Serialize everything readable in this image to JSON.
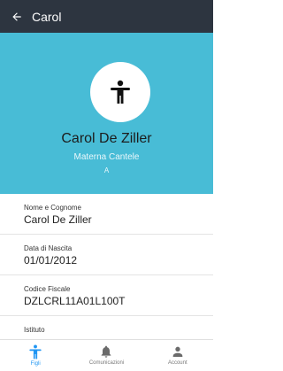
{
  "appbar": {
    "title": "Carol"
  },
  "profile": {
    "name": "Carol De Ziller",
    "school": "Materna Cantele",
    "section": "A"
  },
  "fields": [
    {
      "label": "Nome e Cognome",
      "value": "Carol De Ziller"
    },
    {
      "label": "Data di Nascita",
      "value": "01/01/2012"
    },
    {
      "label": "Codice Fiscale",
      "value": "DZLCRL11A01L100T"
    },
    {
      "label": "Istituto",
      "value": ""
    }
  ],
  "nav": [
    {
      "label": "Figli",
      "icon": "child-icon",
      "active": true
    },
    {
      "label": "Comunicazioni",
      "icon": "bell-icon",
      "active": false
    },
    {
      "label": "Account",
      "icon": "person-icon",
      "active": false
    }
  ],
  "colors": {
    "appbar": "#2d3540",
    "header": "#48bcd6",
    "accent": "#2196f3"
  }
}
